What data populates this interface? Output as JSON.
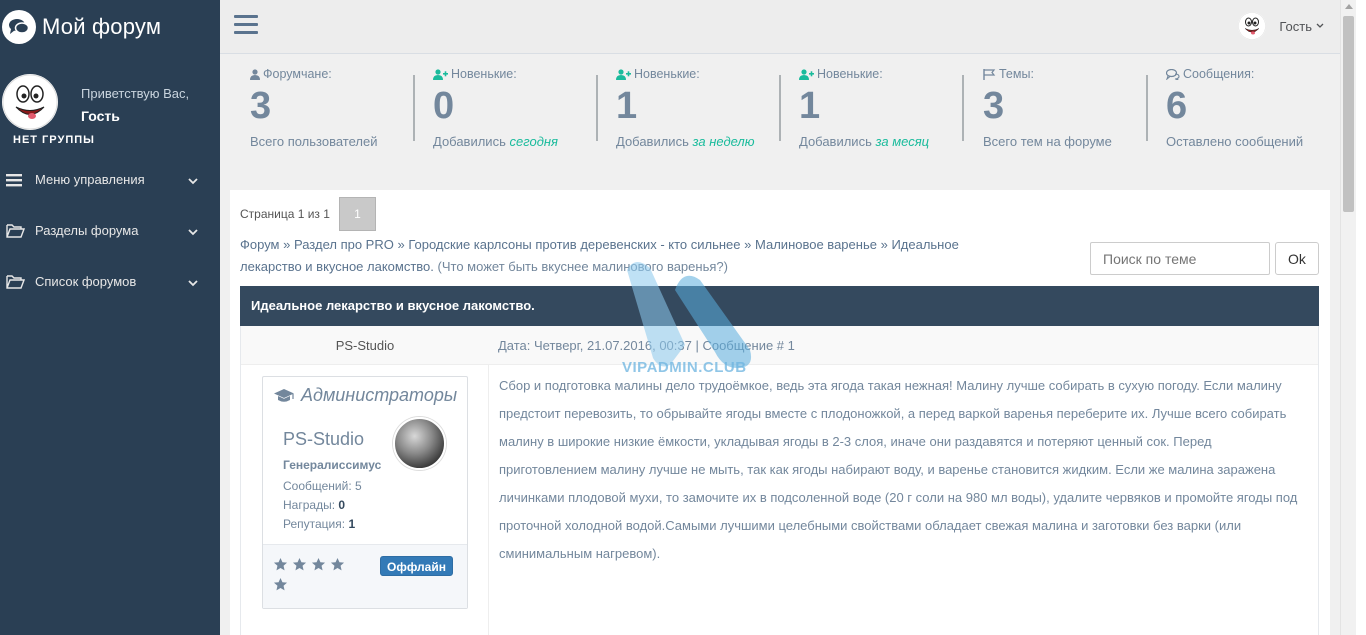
{
  "sidebar": {
    "brand_title": "Мой форум",
    "welcome": "Приветствую Вас,",
    "user_name": "Гость",
    "group": "НЕТ ГРУППЫ",
    "menu": [
      {
        "label": "Меню управления",
        "icon": "bars-icon"
      },
      {
        "label": "Разделы форума",
        "icon": "folder-open-icon"
      },
      {
        "label": "Список форумов",
        "icon": "folder-open-icon"
      }
    ]
  },
  "topbar": {
    "user_label": "Гость"
  },
  "stats": [
    {
      "label": "Форумчане:",
      "count": "3",
      "sub": "Всего пользователей",
      "sub_em": "",
      "icon": "user-icon"
    },
    {
      "label": "Новенькие:",
      "count": "0",
      "sub": "Добавились ",
      "sub_em": "сегодня",
      "icon": "user-plus-icon"
    },
    {
      "label": "Новенькие:",
      "count": "1",
      "sub": "Добавились ",
      "sub_em": "за неделю",
      "icon": "user-plus-icon"
    },
    {
      "label": "Новенькие:",
      "count": "1",
      "sub": "Добавились ",
      "sub_em": "за месяц",
      "icon": "user-plus-icon"
    },
    {
      "label": "Темы:",
      "count": "3",
      "sub": "Всего тем на форуме",
      "sub_em": "",
      "icon": "flag-icon"
    },
    {
      "label": "Сообщения:",
      "count": "6",
      "sub": "Оставлено сообщений",
      "sub_em": "",
      "icon": "comments-icon"
    }
  ],
  "pager": {
    "text": "Страница 1 из 1",
    "current": "1"
  },
  "breadcrumb": {
    "items": [
      "Форум",
      "Раздел про PRO",
      "Городские карлсоны против деревенских - кто сильнее",
      "Малиновое варенье",
      "Идеальное лекарство и вкусное лакомство."
    ],
    "separator": "»",
    "question": "(Что может быть вкуснее малинового варенья?)"
  },
  "search": {
    "placeholder": "Поиск по теме",
    "button": "Ok"
  },
  "topic": {
    "title": "Идеальное лекарство и вкусное лакомство."
  },
  "post": {
    "author": "PS-Studio",
    "meta": "Дата: Четверг, 21.07.2016, 00:37 | Сообщение # 1",
    "group": "Администраторы",
    "name": "PS-Studio",
    "rank": "Генералиссимус",
    "messages_label": "Сообщений: ",
    "messages": "5",
    "awards_label": "Награды: ",
    "awards": "0",
    "reputation_label": "Репутация: ",
    "reputation": "1",
    "stars": 5,
    "status": "Оффлайн",
    "body": "Сбор и подготовка малины дело трудоёмкое, ведь эта ягода такая нежная! Малину лучше собирать в сухую погоду. Если малину предстоит перевозить, то обрывайте ягоды вместе с плодоножкой, а перед варкой варенья переберите их. Лучше всего собирать малину в широкие низкие ёмкости, укладывая ягоды в 2-3 слоя, иначе они раздавятся и потеряют ценный сок. Перед приготовлением малину лучше не мыть, так как ягоды набирают воду, и варенье становится жидким. Если же малина заражена личинками плодовой мухи, то замочите их в подсоленной воде (20 г соли на 980 мл воды), удалите червяков и промойте ягоды под проточной холодной водой.Самыми лучшими целебными свойствами обладает свежая малина и заготовки без варки (или сминимальным нагревом)."
  },
  "watermark": {
    "text": "VIPADMIN.CLUB"
  },
  "colors": {
    "sidebar": "#2a3f54",
    "accent": "#1abb9c",
    "topic_header": "#34495e",
    "offline_button": "#337ab7"
  }
}
